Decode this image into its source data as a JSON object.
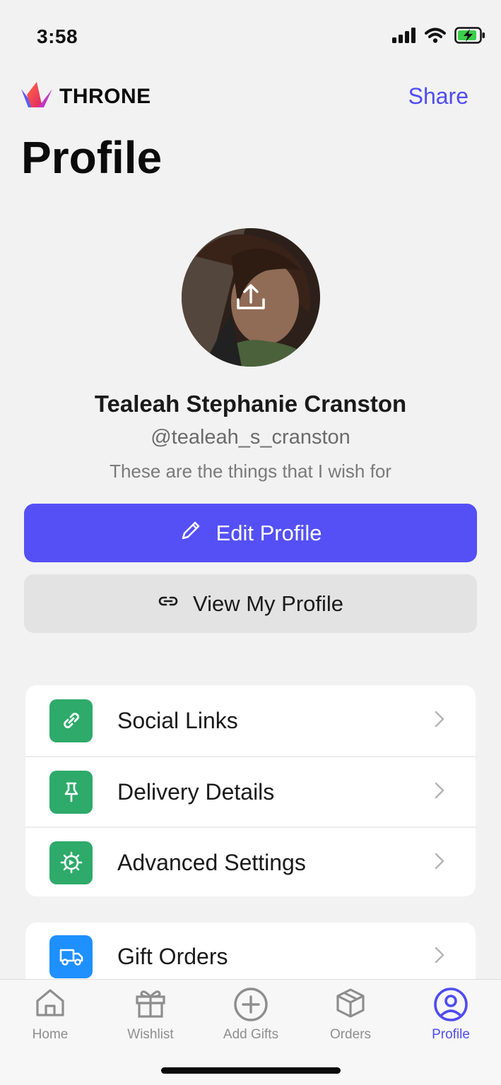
{
  "status_bar": {
    "time": "3:58"
  },
  "header": {
    "brand": "THRONE",
    "share_label": "Share",
    "title": "Profile"
  },
  "profile": {
    "name": "Tealeah Stephanie Cranston",
    "handle": "@tealeah_s_cranston",
    "bio": "These are the things that I wish for"
  },
  "buttons": {
    "edit_label": "Edit Profile",
    "view_label": "View My Profile"
  },
  "settings": {
    "items": [
      {
        "label": "Social Links",
        "icon": "link-icon"
      },
      {
        "label": "Delivery Details",
        "icon": "pin-icon"
      },
      {
        "label": "Advanced Settings",
        "icon": "gear-icon"
      }
    ]
  },
  "orders": {
    "items": [
      {
        "label": "Gift Orders",
        "icon": "truck-icon"
      }
    ]
  },
  "tabs": [
    {
      "label": "Home",
      "icon": "home-icon"
    },
    {
      "label": "Wishlist",
      "icon": "gift-icon"
    },
    {
      "label": "Add Gifts",
      "icon": "plus-circle-icon"
    },
    {
      "label": "Orders",
      "icon": "box-icon"
    },
    {
      "label": "Profile",
      "icon": "user-circle-icon",
      "active": true
    }
  ],
  "colors": {
    "accent": "#5450f5",
    "settings_icon_bg": "#2eaa6a",
    "orders_icon_bg": "#1e90ff",
    "background": "#f2f2f2"
  }
}
